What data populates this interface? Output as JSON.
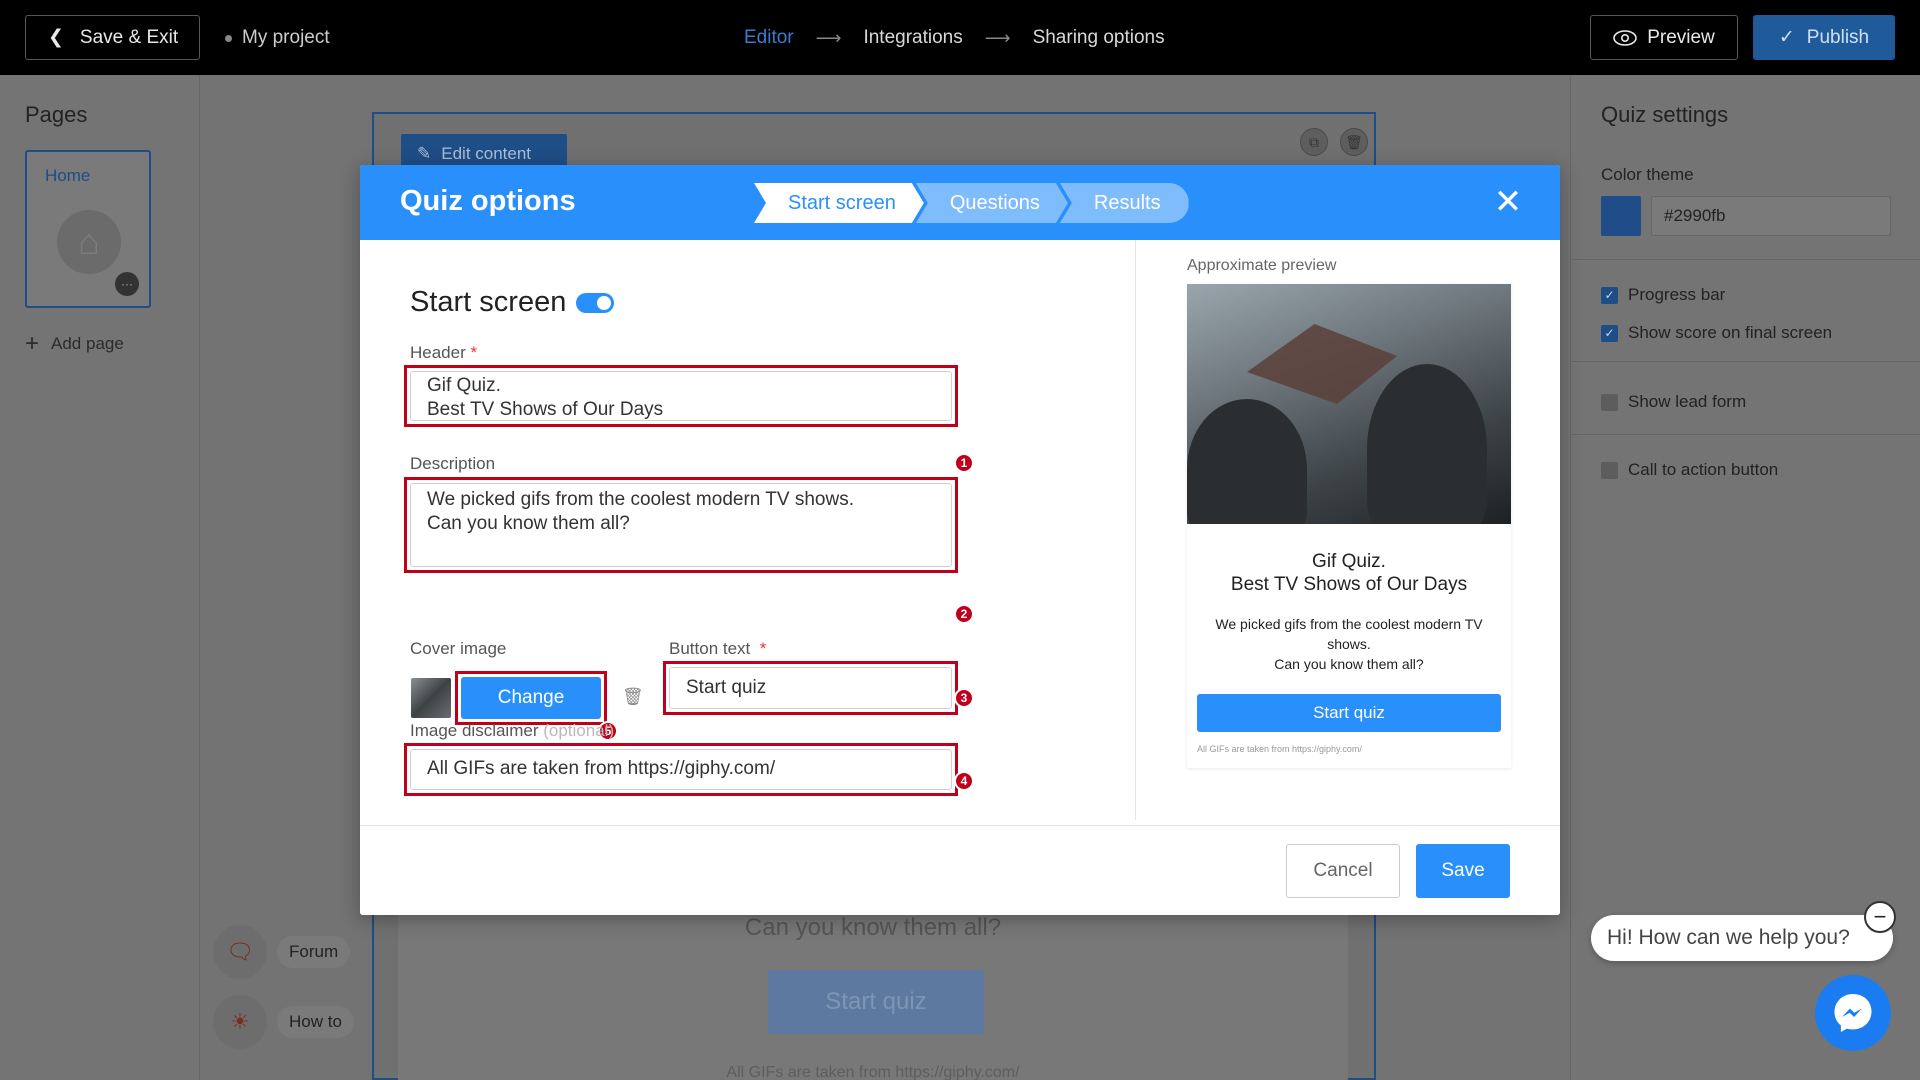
{
  "topbar": {
    "save_exit": "Save & Exit",
    "project_name": "My project",
    "steps": [
      "Editor",
      "Integrations",
      "Sharing options"
    ],
    "active_step": "Editor",
    "preview": "Preview",
    "publish": "Publish"
  },
  "left_sidebar": {
    "title": "Pages",
    "page_card_label": "Home",
    "add_page": "Add page",
    "help": [
      "Forum",
      "How to"
    ]
  },
  "canvas": {
    "edit_content": "Edit content",
    "question_text": "Can you know them all?",
    "start_button": "Start quiz",
    "disclaimer": "All GIFs are taken from https://giphy.com/"
  },
  "right_sidebar": {
    "title": "Quiz settings",
    "color_theme_label": "Color theme",
    "color_theme_value": "#2990fb",
    "options": [
      {
        "label": "Progress bar",
        "checked": true
      },
      {
        "label": "Show score on final screen",
        "checked": true
      },
      {
        "label": "Show lead form",
        "checked": false
      },
      {
        "label": "Call to action button",
        "checked": false
      }
    ]
  },
  "modal": {
    "title": "Quiz options",
    "tabs": [
      "Start screen",
      "Questions",
      "Results"
    ],
    "active_tab": "Start screen",
    "section_title": "Start screen",
    "header_label": "Header",
    "header_value": "Gif Quiz.\nBest TV Shows of Our Days",
    "description_label": "Description",
    "description_value": "We picked gifs from the coolest modern TV shows.\nCan you know them all?",
    "cover_image_label": "Cover image",
    "change_button": "Change",
    "button_text_label": "Button text",
    "button_text_value": "Start quiz",
    "image_disclaimer_label": "Image disclaimer",
    "optional_hint": "(optional)",
    "image_disclaimer_value": "All GIFs are taken from https://giphy.com/",
    "badges": [
      "1",
      "2",
      "3",
      "4",
      "5"
    ],
    "cancel": "Cancel",
    "save": "Save"
  },
  "preview": {
    "label": "Approximate preview",
    "title": "Gif Quiz.\nBest TV Shows of Our Days",
    "description": "We picked gifs from the coolest modern TV shows.\nCan you know them all?",
    "button": "Start quiz",
    "disclaimer": "All GIFs are taken from https://giphy.com/"
  },
  "chat": {
    "greeting": "Hi! How can we help you?"
  },
  "colors": {
    "accent": "#2990fb",
    "annotation_red": "#c0001a"
  }
}
